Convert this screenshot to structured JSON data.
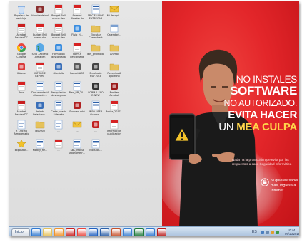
{
  "desktop": {
    "icons": [
      {
        "label": "Papelera de reciclaje",
        "icon": "recycle-bin-icon",
        "color": "#3b7fd1"
      },
      {
        "label": "Vanbhaldstool",
        "icon": "app-shortcut-icon",
        "color": "#8b2f2f"
      },
      {
        "label": "Budget Brill nuevo deo",
        "icon": "pdf-icon",
        "color": "#d62222"
      },
      {
        "label": "Solmari Bleeder fin",
        "icon": "pdf-icon",
        "color": "#d62222"
      },
      {
        "label": "MBC FLUXOS ENTREGAR",
        "icon": "document-icon",
        "color": "#2b5fa8"
      },
      {
        "label": "Mi Recopil...",
        "icon": "envelope-icon",
        "color": "#f0c23a"
      },
      {
        "label": "Acrobat Reader DC",
        "icon": "pdf-icon",
        "color": "#c91f1f"
      },
      {
        "label": "Budget Brill nuevo deo",
        "icon": "pdf-icon",
        "color": "#d62222"
      },
      {
        "label": "Budget Brill nuevo deo",
        "icon": "pdf-icon",
        "color": "#d62222"
      },
      {
        "label": "Flujo_H...",
        "icon": "shortcut-icon",
        "color": "#3a8ddf"
      },
      {
        "label": "Ejecutar Chemsheet",
        "icon": "folder-icon",
        "color": "#e6c25a"
      },
      {
        "label": "Calendari...",
        "icon": "calendar-icon",
        "color": "#7a9fd0"
      },
      {
        "label": "Google Chrome",
        "icon": "chrome-icon",
        "color": "#e8453c"
      },
      {
        "label": "SMB - Acceso Almacen",
        "icon": "globe-icon",
        "color": "#2f8f3f"
      },
      {
        "label": "Formación descargada",
        "icon": "cloud-icon",
        "color": "#3a8ddf"
      },
      {
        "label": "Form-F descargada",
        "icon": "pdf-icon",
        "color": "#d62222"
      },
      {
        "label": "dbs_productal",
        "icon": "folder-icon",
        "color": "#e6c25a"
      },
      {
        "label": "Animal",
        "icon": "folder-icon",
        "color": "#e6c25a"
      },
      {
        "label": "Kdrone",
        "icon": "app-icon",
        "color": "#d83b3b"
      },
      {
        "label": "INFORME REPORT",
        "icon": "pdf-icon",
        "color": "#d62222"
      },
      {
        "label": "Giordello",
        "icon": "network-icon",
        "color": "#3a6fb8"
      },
      {
        "label": "Paquet ADF",
        "icon": "camera-icon",
        "color": "#5a5a5a"
      },
      {
        "label": "Empleado RSP 2018",
        "icon": "book-icon",
        "color": "#444444"
      },
      {
        "label": "Recopilació oportuno",
        "icon": "folder-icon",
        "color": "#e6c25a"
      },
      {
        "label": "Prise",
        "icon": "pdf-icon",
        "color": "#d62222"
      },
      {
        "label": "Documentación ciliada de...",
        "icon": "document-icon",
        "color": "#2b5fa8"
      },
      {
        "label": "Recopilación descargada",
        "icon": "document-icon",
        "color": "#2b5fa8"
      },
      {
        "label": "Plan_BR_20...",
        "icon": "document-icon",
        "color": "#2b5fa8"
      },
      {
        "label": "FORM 1-ESO E-NEW",
        "icon": "image-icon",
        "color": "#333333"
      },
      {
        "label": "Bonitas Acrobat",
        "icon": "app-icon",
        "color": "#9a1b1b"
      },
      {
        "label": "Acrobat Reader DC",
        "icon": "pdf-icon",
        "color": "#c91f1f"
      },
      {
        "label": "Reliado Relaciono...",
        "icon": "network-icon",
        "color": "#3a6fb8"
      },
      {
        "label": "Carta Jurado Liderado",
        "icon": "document-icon",
        "color": "#2b5fa8"
      },
      {
        "label": "Spoofed.mht",
        "icon": "app-icon",
        "color": "#b02020"
      },
      {
        "label": "INFO USER Alumno...",
        "icon": "document-icon",
        "color": "#2b5fa8"
      },
      {
        "label": "Rodas_2017...",
        "icon": "pdf-icon",
        "color": "#d62222"
      },
      {
        "label": "R_Oficina Almacenado",
        "icon": "document-icon",
        "color": "#2b5fa8"
      },
      {
        "label": "jd00000",
        "icon": "folder-icon",
        "color": "#e6c25a"
      },
      {
        "label": "...",
        "icon": "document-icon",
        "color": "#2b5fa8"
      },
      {
        "label": "...",
        "icon": "envelope-icon",
        "color": "#f0c23a"
      },
      {
        "label": "...",
        "icon": "app-icon",
        "color": "#c02020"
      },
      {
        "label": "Informacion publicacion",
        "icon": "pdf-icon",
        "color": "#d62222"
      },
      {
        "label": "Expositor...",
        "icon": "star-icon",
        "color": "#f2c22a"
      },
      {
        "label": "Modify_Re...",
        "icon": "document-icon",
        "color": "#2b5fa8"
      },
      {
        "label": "...",
        "icon": "pdf-icon",
        "color": "#d62222"
      },
      {
        "label": "SBC_Modul Abonarse F...",
        "icon": "document-icon",
        "color": "#2b5fa8"
      },
      {
        "label": "Modulos...",
        "icon": "document-icon",
        "color": "#2b5fa8"
      }
    ]
  },
  "wallpaper": {
    "headline": {
      "line1": "NO INSTALES",
      "line2": "SOFTWARE",
      "line3": "NO AUTORIZADO.",
      "line4": "EVITA HACER",
      "line5_prefix": "UN",
      "line5_accent": "MEA CULPA"
    },
    "tagline": "Nada ha la protección que evita por las respuestas a caso Seguridad informática",
    "info_text": "Si quieres saber más, ingresa a Intranet",
    "colors": {
      "background": "#e3262a",
      "accent": "#ffd54a",
      "text": "#ffffff"
    }
  },
  "taskbar": {
    "start_label": "Inicio",
    "pinned": [
      {
        "icon": "ie-icon",
        "color": "#2f78d0"
      },
      {
        "icon": "explorer-folder-icon",
        "color": "#e6c25a"
      },
      {
        "icon": "media-player-icon",
        "color": "#f0932b"
      },
      {
        "icon": "acrobat-icon",
        "color": "#c91f1f"
      },
      {
        "icon": "chrome-icon",
        "color": "#e8453c"
      },
      {
        "icon": "outlook-icon",
        "color": "#1f5fbf"
      },
      {
        "icon": "word-icon",
        "color": "#2b5fa8"
      },
      {
        "icon": "powerpoint-icon",
        "color": "#c5502a"
      },
      {
        "icon": "lync-icon",
        "color": "#3a7fd1"
      },
      {
        "icon": "excel-icon",
        "color": "#1f7a3a"
      },
      {
        "icon": "paint-icon",
        "color": "#2f78d0"
      },
      {
        "icon": "acrobat-reader-icon",
        "color": "#b81b1b"
      }
    ],
    "tray": {
      "language": "ES",
      "time": "10:44",
      "date": "09/10/2019"
    }
  }
}
